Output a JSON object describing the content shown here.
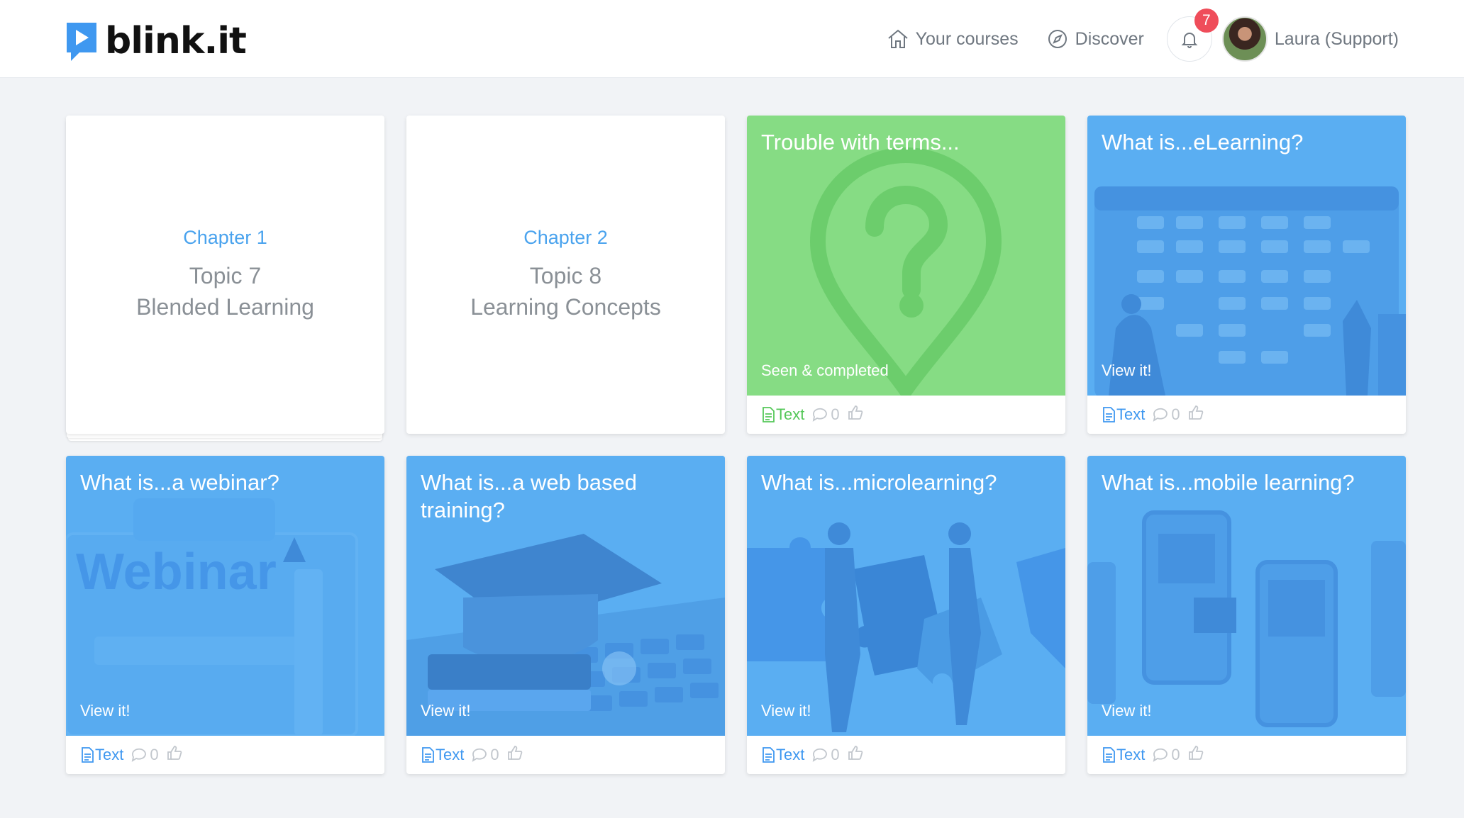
{
  "brand": {
    "name": "blink.it",
    "color": "#3f98f0"
  },
  "nav": {
    "your_courses": "Your courses",
    "discover": "Discover",
    "notifications_count": "7",
    "user_name": "Laura (Support)"
  },
  "chapters": [
    {
      "label": "Chapter 1",
      "topic": "Topic 7",
      "subtitle": "Blended Learning"
    },
    {
      "label": "Chapter 2",
      "topic": "Topic 8",
      "subtitle": "Learning Concepts"
    }
  ],
  "lessons": [
    {
      "title": "Trouble with terms...",
      "status": "Seen & completed",
      "type": "Text",
      "comments": "0",
      "color": "#86dc84",
      "accent": "#56c85a",
      "icon": "question-pin"
    },
    {
      "title": "What is...eLearning?",
      "status": "View it!",
      "type": "Text",
      "comments": "0",
      "color": "#5aaef2",
      "accent": "#3f98f0",
      "icon": "elearning-illustration"
    },
    {
      "title": "What is...a webinar?",
      "status": "View it!",
      "type": "Text",
      "comments": "0",
      "color": "#5aaef2",
      "accent": "#3f98f0",
      "icon": "webinar-illustration",
      "art_text": "Webinar"
    },
    {
      "title": "What is...a web based training?",
      "status": "View it!",
      "type": "Text",
      "comments": "0",
      "color": "#5aaef2",
      "accent": "#3f98f0",
      "icon": "graduation-cap-laptop"
    },
    {
      "title": "What is...microlearning?",
      "status": "View it!",
      "type": "Text",
      "comments": "0",
      "color": "#5aaef2",
      "accent": "#3f98f0",
      "icon": "puzzle-illustration"
    },
    {
      "title": "What is...mobile learning?",
      "status": "View it!",
      "type": "Text",
      "comments": "0",
      "color": "#5aaef2",
      "accent": "#3f98f0",
      "icon": "mobile-phones-illustration"
    }
  ]
}
